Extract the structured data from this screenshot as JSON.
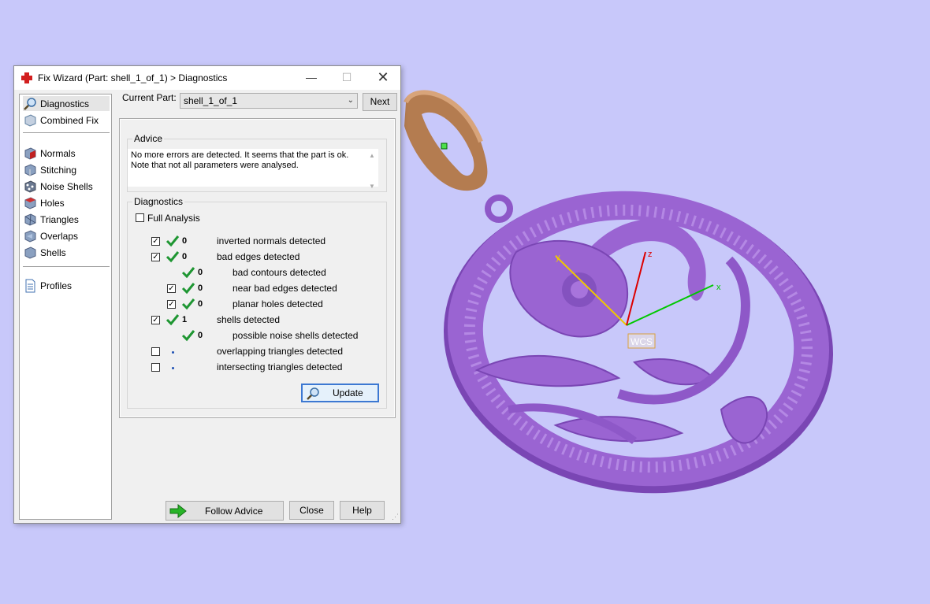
{
  "window": {
    "title": "Fix Wizard (Part: shell_1_of_1) > Diagnostics"
  },
  "sidebar": {
    "items": [
      {
        "label": "Diagnostics",
        "icon": "magnifier-icon"
      },
      {
        "label": "Combined Fix",
        "icon": "cube-icon"
      },
      {
        "label": "Normals",
        "icon": "normals-cube-icon"
      },
      {
        "label": "Stitching",
        "icon": "stitching-cube-icon"
      },
      {
        "label": "Noise Shells",
        "icon": "noise-shells-icon"
      },
      {
        "label": "Holes",
        "icon": "holes-cube-icon"
      },
      {
        "label": "Triangles",
        "icon": "triangles-cube-icon"
      },
      {
        "label": "Overlaps",
        "icon": "overlaps-cube-icon"
      },
      {
        "label": "Shells",
        "icon": "shells-cube-icon"
      },
      {
        "label": "Profiles",
        "icon": "profiles-doc-icon"
      }
    ],
    "selected": "Diagnostics"
  },
  "current_part": {
    "label": "Current Part:",
    "value": "shell_1_of_1",
    "next_label": "Next"
  },
  "advice": {
    "title": "Advice",
    "line1": "No more errors are detected. It seems that the part is ok.",
    "line2": "Note that not all parameters were analysed."
  },
  "diagnostics": {
    "title": "Diagnostics",
    "full_analysis_label": "Full Analysis",
    "full_analysis_checked": false,
    "rows": [
      {
        "checked": true,
        "status": "ok",
        "count": "0",
        "text": "inverted normals detected",
        "indent": 0
      },
      {
        "checked": true,
        "status": "ok",
        "count": "0",
        "text": "bad edges detected",
        "indent": 0
      },
      {
        "checked": null,
        "status": "ok",
        "count": "0",
        "text": "bad contours detected",
        "indent": 1
      },
      {
        "checked": true,
        "status": "ok",
        "count": "0",
        "text": "near bad edges detected",
        "indent": 1
      },
      {
        "checked": true,
        "status": "ok",
        "count": "0",
        "text": "planar holes detected",
        "indent": 1
      },
      {
        "checked": true,
        "status": "ok",
        "count": "1",
        "text": "shells detected",
        "indent": 0
      },
      {
        "checked": null,
        "status": "ok",
        "count": "0",
        "text": "possible noise shells detected",
        "indent": 1
      },
      {
        "checked": false,
        "status": "pending",
        "count": "",
        "text": "overlapping triangles detected",
        "indent": 0
      },
      {
        "checked": false,
        "status": "pending",
        "count": "",
        "text": "intersecting triangles detected",
        "indent": 0
      }
    ],
    "update_label": "Update"
  },
  "footer": {
    "follow_advice_label": "Follow Advice",
    "close_label": "Close",
    "help_label": "Help"
  },
  "viewport": {
    "wcs_label": "WCS",
    "axis_x": "x",
    "axis_y": "y",
    "axis_z": "z",
    "colors": {
      "background": "#c8c8fa",
      "part": "#9a64d2",
      "part_dark": "#6e3ca5",
      "bail": "#b47c50",
      "axis_x": "#00c800",
      "axis_y": "#f0c800",
      "axis_z": "#dc0000"
    }
  }
}
